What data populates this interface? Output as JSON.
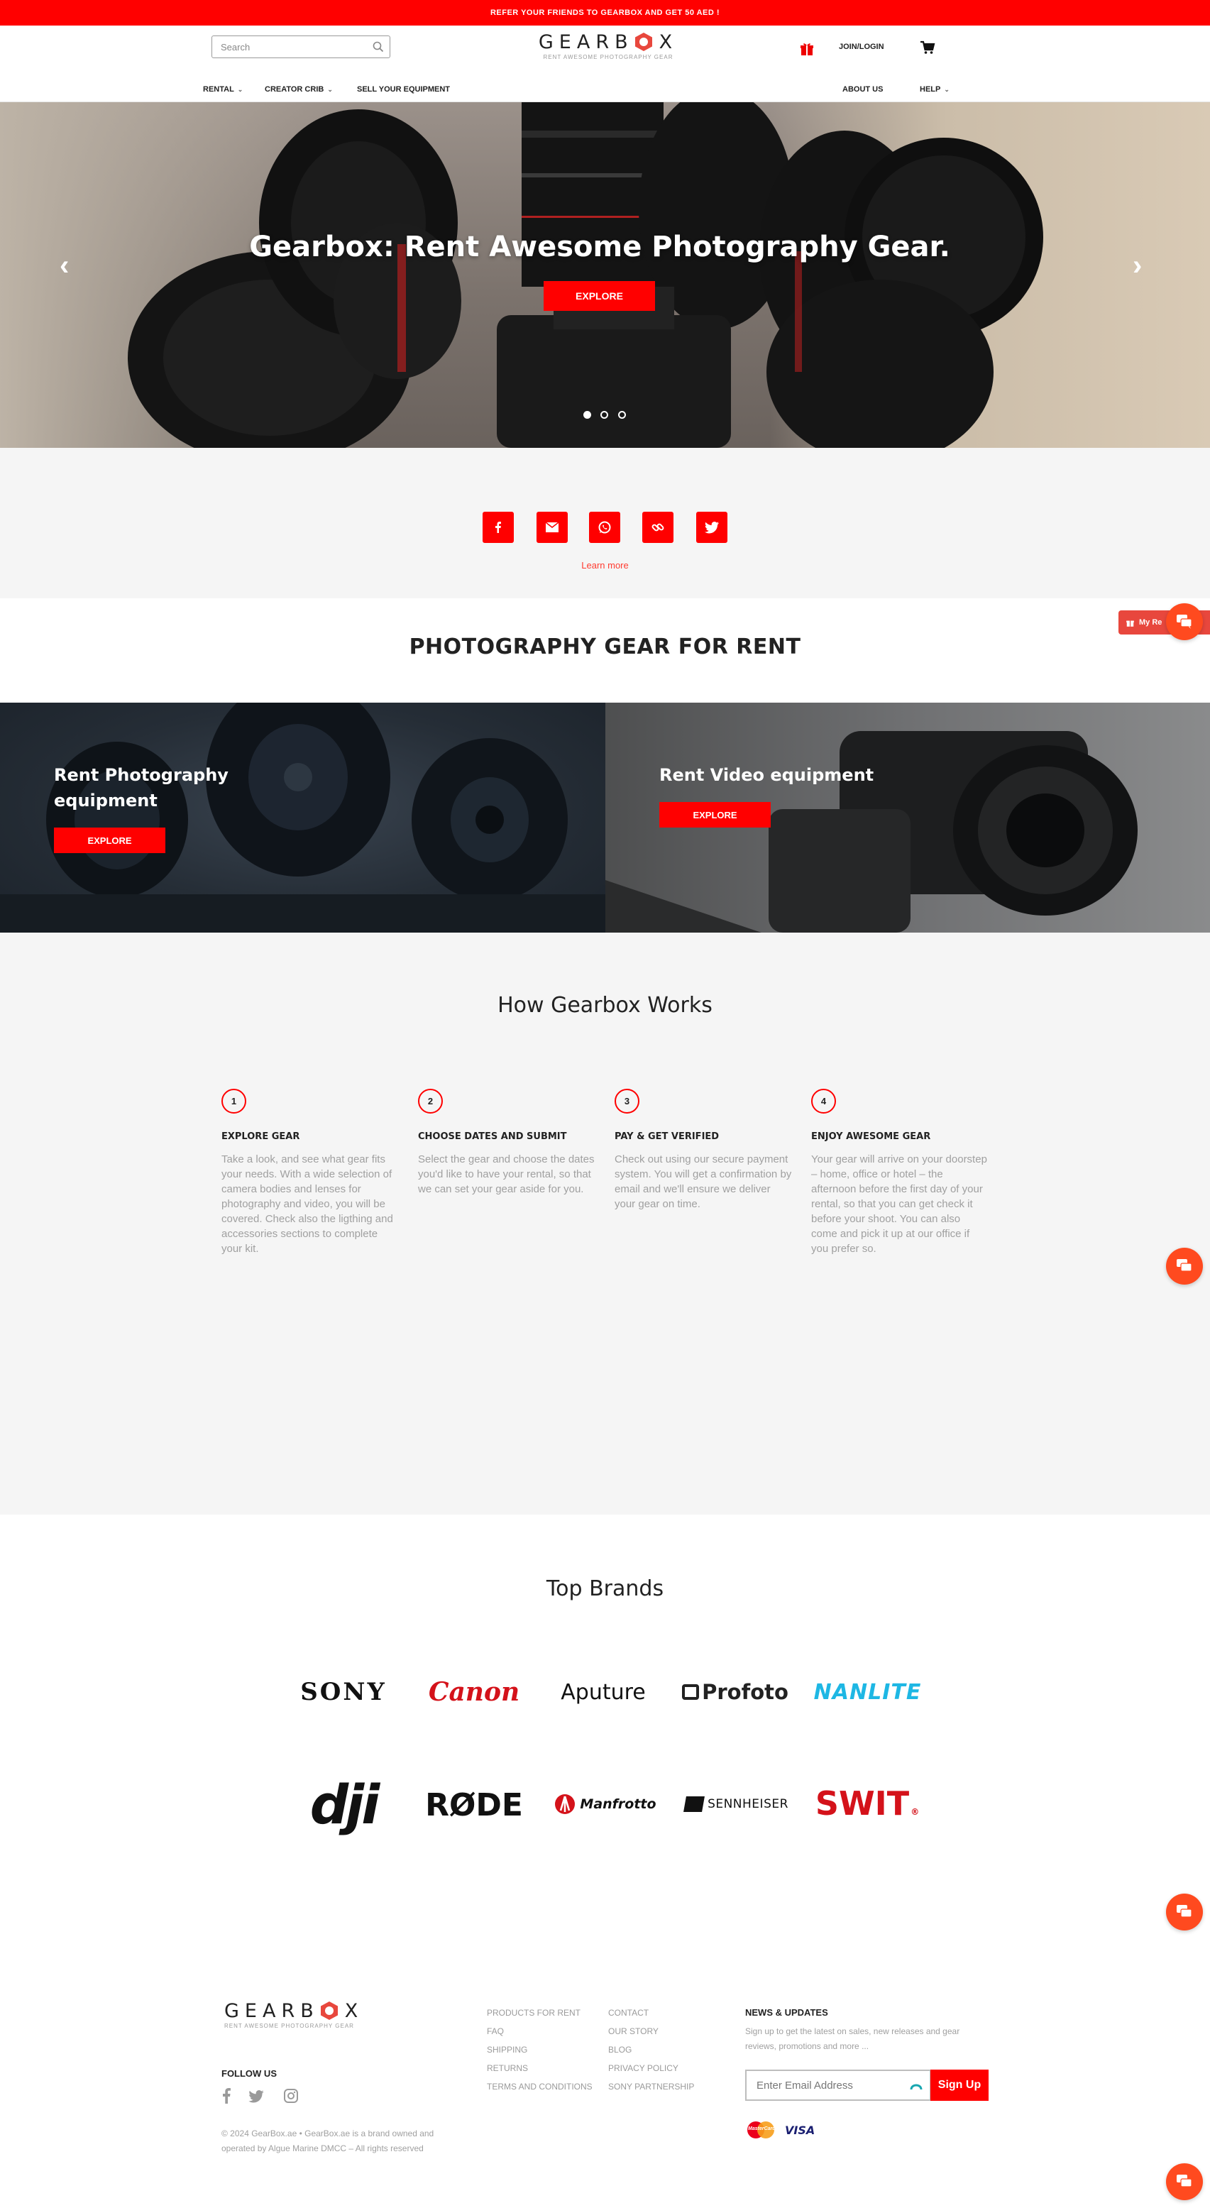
{
  "promo": {
    "text": "REFER YOUR FRIENDS TO GEARBOX AND GET 50 AED !"
  },
  "header": {
    "search_placeholder": "Search",
    "logo_text_left": "GEARB",
    "logo_text_right": "X",
    "logo_tagline": "RENT AWESOME PHOTOGRAPHY GEAR",
    "join_label": "JOIN/LOGIN",
    "nav_left": [
      {
        "label": "RENTAL",
        "has_dropdown": true
      },
      {
        "label": "CREATOR CRIB",
        "has_dropdown": true
      },
      {
        "label": "SELL YOUR EQUIPMENT",
        "has_dropdown": false
      }
    ],
    "nav_right": [
      {
        "label": "ABOUT US",
        "has_dropdown": false
      },
      {
        "label": "HELP",
        "has_dropdown": true
      }
    ]
  },
  "hero": {
    "title": "Gearbox: Rent Awesome Photography Gear.",
    "button": "EXPLORE",
    "prev_icon": "chevron-left-icon",
    "next_icon": "chevron-right-icon",
    "dots_count": 3,
    "active_dot": 1
  },
  "social": {
    "icons": [
      "facebook-icon",
      "email-icon",
      "whatsapp-icon",
      "link-icon",
      "twitter-icon"
    ],
    "learn_more": "Learn more"
  },
  "rent_section": {
    "heading": "PHOTOGRAPHY GEAR FOR RENT",
    "photo": {
      "title_line1": "Rent Photography",
      "title_line2": "equipment",
      "button": "EXPLORE"
    },
    "video": {
      "title": "Rent Video equipment",
      "button": "EXPLORE"
    }
  },
  "how": {
    "heading": "How Gearbox Works",
    "steps": [
      {
        "num": "1",
        "title": "EXPLORE GEAR",
        "text": "Take a look, and see what gear fits your needs. With a wide selection of camera bodies and lenses for photography and video, you will be covered. Check also the ligthing and accessories sections to complete your kit."
      },
      {
        "num": "2",
        "title": "CHOOSE DATES AND SUBMIT",
        "text": "Select the gear and choose the dates you'd like to have your rental, so that we can set your gear aside for you."
      },
      {
        "num": "3",
        "title": "PAY & GET VERIFIED",
        "text": "Check out using our secure payment system. You will get a confirmation by email and we'll ensure we deliver your gear on time."
      },
      {
        "num": "4",
        "title": "ENJOY AWESOME GEAR",
        "text": "Your gear will arrive on your doorstep – home, office or hotel – the afternoon before the first day of your rental, so that you can get check it before your shoot. You can also come and pick it up at our office if you prefer so."
      }
    ]
  },
  "brands": {
    "heading": "Top Brands",
    "row1": [
      "SONY",
      "Canon",
      "Aputure",
      "Profoto",
      "NANLITE"
    ],
    "row2": [
      "dji",
      "RØDE",
      "Manfrotto",
      "SENNHEISER",
      "SWIT"
    ]
  },
  "rewards": {
    "label": "My Re"
  },
  "footer": {
    "logo_text_left": "GEARB",
    "logo_text_right": "X",
    "logo_tagline": "RENT AWESOME PHOTOGRAPHY GEAR",
    "follow_us": "FOLLOW US",
    "col1": [
      "PRODUCTS FOR RENT",
      "FAQ",
      "SHIPPING",
      "RETURNS",
      "TERMS AND CONDITIONS"
    ],
    "col2": [
      "CONTACT",
      "OUR STORY",
      "BLOG",
      "PRIVACY POLICY",
      "SONY PARTNERSHIP"
    ],
    "news_title": "NEWS & UPDATES",
    "news_text": "Sign up to get the latest on sales, new releases and gear reviews, promotions and more ...",
    "email_placeholder": "Enter Email Address",
    "signup": "Sign Up",
    "copyright_line1": "© 2024 GearBox.ae • GearBox.ae is a brand owned and",
    "copyright_line2": "operated by Algue Marine DMCC – All rights reserved",
    "payment": [
      "MasterCard",
      "VISA"
    ]
  },
  "colors": {
    "accent": "#ff0000",
    "chat": "#ff4a1f",
    "panel_text": "#ffffff",
    "muted": "#a0a0a0"
  }
}
